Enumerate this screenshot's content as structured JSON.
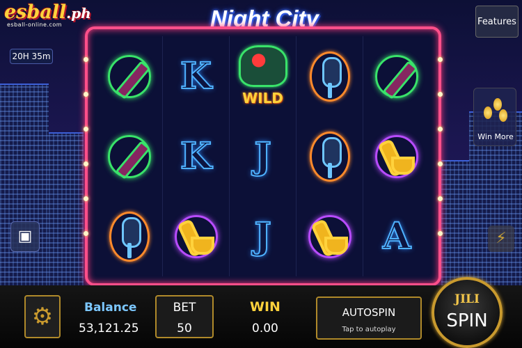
{
  "game_title": "Night City",
  "logo": {
    "main_text": "esball",
    "suffix": ".ph",
    "sub_text": "esball-online.com"
  },
  "timer": "20H 35m",
  "features_label": "Features",
  "win_more_label": "Win More",
  "reels": [
    [
      "bottle",
      "K",
      "wild",
      "mic",
      "bottle"
    ],
    [
      "bottle",
      "K",
      "J",
      "mic",
      "sax"
    ],
    [
      "mic",
      "sax",
      "J",
      "sax",
      "A"
    ]
  ],
  "wild_label": "WILD",
  "bottom_bar": {
    "balance_label": "Balance",
    "balance_value": "53,121.25",
    "bet_label": "BET",
    "bet_value": "50",
    "win_label": "WIN",
    "win_value": "0.00",
    "autospin_label": "AUTOSPIN",
    "autospin_sub": "Tap to autoplay",
    "spin_brand": "JILI",
    "spin_label": "SPIN"
  },
  "icons": [
    "settings-gear-icon",
    "bag-icon",
    "lightning-icon",
    "coins-icon"
  ],
  "colors": {
    "frame": "#ff4f8a",
    "gold": "#c99a2e",
    "title_glow": "#2f5cff"
  }
}
